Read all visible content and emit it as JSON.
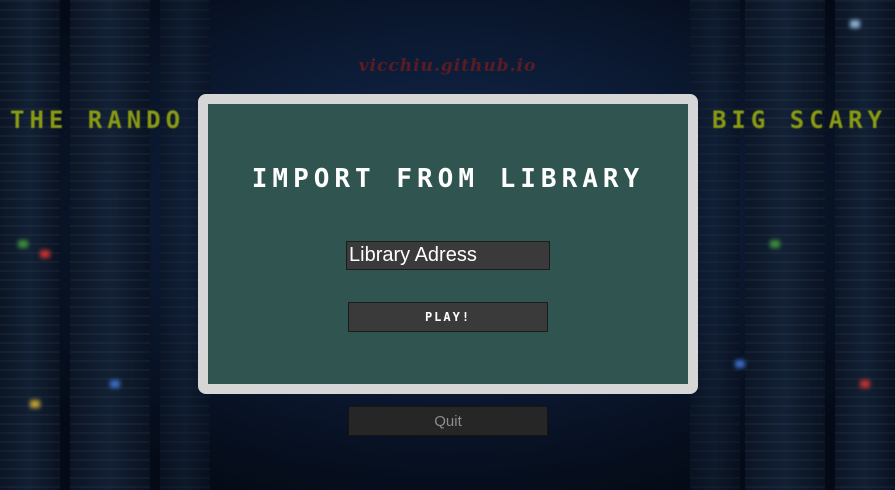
{
  "background": {
    "title_left": "THE RANDO",
    "title_right": "BIG SCARY",
    "site_credit": "vicchiu.github.io"
  },
  "modal": {
    "heading": "IMPORT FROM LIBRARY",
    "input_placeholder": "Library Adress",
    "play_label": "PLAY!"
  },
  "quit_label": "Quit",
  "colors": {
    "modal_bg": "#305550",
    "modal_frame": "#d6d6d6",
    "title_text": "#8a9a12",
    "button_bg": "#3a3a3a"
  }
}
